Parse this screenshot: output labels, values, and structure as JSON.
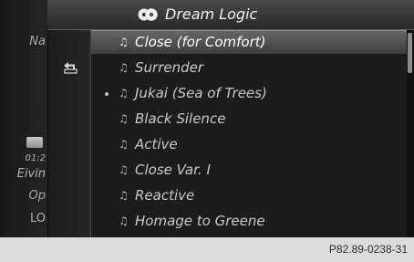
{
  "header": {
    "icon": "cd-disc-icon",
    "title": "Dream Logic"
  },
  "left_strip": {
    "nav_label": "Na",
    "time_text": "01:2",
    "status_text": "Eivin",
    "option_label": "Op",
    "lower_label": "LO"
  },
  "back_button": {
    "icon": "back-arrow-icon"
  },
  "tracks": [
    {
      "title": "Close (for Comfort)",
      "selected": true,
      "playing": false,
      "icon": "music-note-icon"
    },
    {
      "title": "Surrender",
      "selected": false,
      "playing": false,
      "icon": "music-note-icon"
    },
    {
      "title": "Jukai (Sea of Trees)",
      "selected": false,
      "playing": true,
      "icon": "music-note-icon"
    },
    {
      "title": "Black Silence",
      "selected": false,
      "playing": false,
      "icon": "music-note-icon"
    },
    {
      "title": "Active",
      "selected": false,
      "playing": false,
      "icon": "music-note-icon"
    },
    {
      "title": "Close Var. I",
      "selected": false,
      "playing": false,
      "icon": "music-note-icon"
    },
    {
      "title": "Reactive",
      "selected": false,
      "playing": false,
      "icon": "music-note-icon"
    },
    {
      "title": "Homage to Greene",
      "selected": false,
      "playing": false,
      "icon": "music-note-icon"
    }
  ],
  "footer": {
    "reference_code": "P82.89-0238-31"
  },
  "colors": {
    "background": "#1c1c1c",
    "selected_row": "#5a5a5a",
    "text": "#c9c9c9",
    "footer": "#dbdbdb"
  }
}
